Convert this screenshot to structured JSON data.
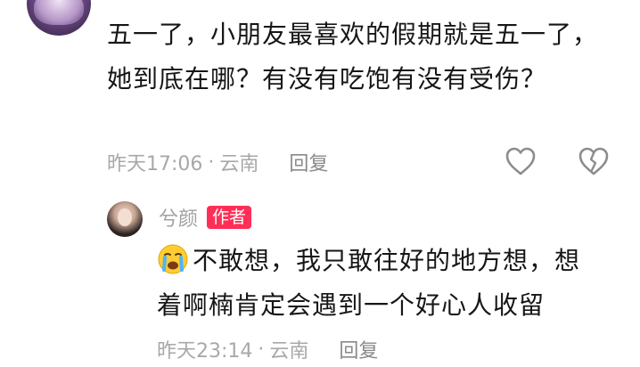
{
  "comment": {
    "text": "五一了，小朋友最喜欢的假期就是五一了，她到底在哪？有没有吃饱有没有受伤？",
    "time": "昨天17:06",
    "separator": "·",
    "location": "云南",
    "reply_label": "回复",
    "like_icon": "heart-outline-icon",
    "dislike_icon": "broken-heart-icon"
  },
  "reply": {
    "author": "兮颜",
    "author_badge": "作者",
    "badge_color": "#ff2e56",
    "emoji": "crying-face-emoji",
    "text": "不敢想，我只敢往好的地方想，想着啊楠肯定会遇到一个好心人收留",
    "time": "昨天23:14",
    "separator": "·",
    "location": "云南",
    "reply_label": "回复"
  }
}
